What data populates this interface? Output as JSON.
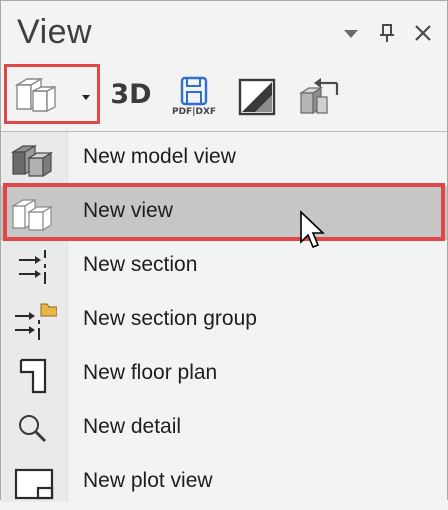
{
  "panel": {
    "title": "View",
    "header_icons": [
      "dropdown-triangle-icon",
      "pin-icon",
      "close-icon"
    ]
  },
  "toolbar": {
    "new_view_button_icon": "new-view-icon",
    "dropdown_icon": "small-down-arrow-icon",
    "button_3d_label": "3D",
    "pdf_dxf_label": "PDF|DXF",
    "perspective_icon": "perspective-icon",
    "export_view_icon": "export-view-icon"
  },
  "menu": {
    "items": [
      {
        "label": "New model view",
        "icon": "model-view-icon"
      },
      {
        "label": "New view",
        "icon": "new-view-icon",
        "active": true
      },
      {
        "label": "New section",
        "icon": "section-icon"
      },
      {
        "label": "New section group",
        "icon": "section-group-icon"
      },
      {
        "label": "New floor plan",
        "icon": "floor-plan-icon"
      },
      {
        "label": "New detail",
        "icon": "magnifier-icon"
      },
      {
        "label": "New plot view",
        "icon": "plot-view-icon"
      }
    ]
  },
  "colors": {
    "highlight_border": "#e04848",
    "active_row": "#c6c6c6",
    "panel_bg": "#f3f3f3",
    "save_icon_blue": "#2f6fd1"
  }
}
